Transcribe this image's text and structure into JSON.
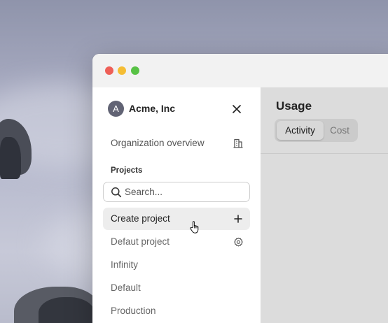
{
  "org": {
    "avatar_letter": "A",
    "name": "Acme, Inc"
  },
  "sidebar": {
    "overview_label": "Organization overview",
    "projects_heading": "Projects",
    "search_placeholder": "Search...",
    "items": [
      {
        "label": "Create project",
        "icon": "plus-icon"
      },
      {
        "label": "Defaut project",
        "icon": "gear-icon"
      },
      {
        "label": "Infinity"
      },
      {
        "label": "Default"
      },
      {
        "label": "Production"
      }
    ]
  },
  "main": {
    "title": "Usage",
    "tabs": [
      {
        "label": "Activity",
        "active": true
      },
      {
        "label": "Cost",
        "active": false
      }
    ]
  },
  "colors": {
    "window_chrome": "#f2f2f2",
    "sidebar_bg": "#ffffff",
    "main_bg": "#dcdcdc",
    "avatar_bg": "#616374",
    "close_red": "#ee5f57",
    "minimize_yellow": "#f5bd34",
    "zoom_green": "#58c245"
  }
}
